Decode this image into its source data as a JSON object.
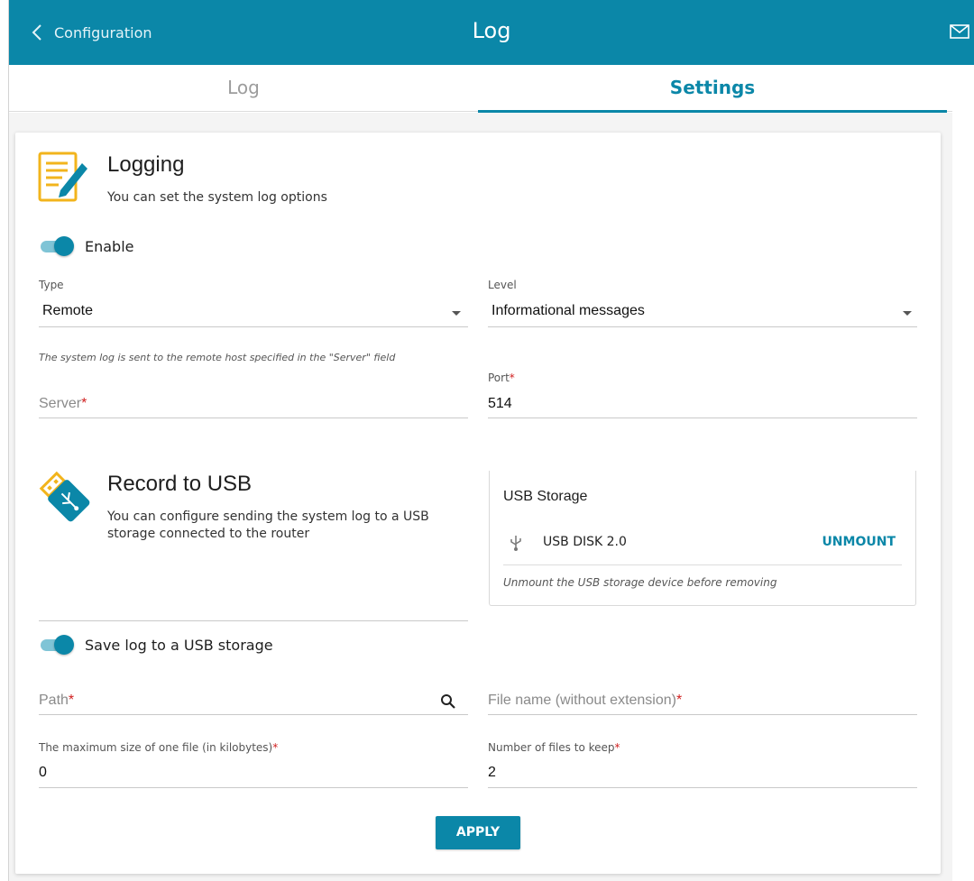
{
  "header": {
    "back_label": "Configuration",
    "title": "Log",
    "mail_icon": "mail-icon"
  },
  "tabs": [
    {
      "label": "Log",
      "active": false
    },
    {
      "label": "Settings",
      "active": true
    }
  ],
  "logging": {
    "title": "Logging",
    "description": "You can set the system log options",
    "icon": "notepad-pencil-icon",
    "enable_label": "Enable",
    "enable_on": true,
    "type_label": "Type",
    "type_value": "Remote",
    "level_label": "Level",
    "level_value": "Informational messages",
    "type_hint": "The system log is sent to the remote host specified in the \"Server\" field",
    "server_placeholder": "Server",
    "port_label": "Port",
    "port_value": "514",
    "required_mark": "*"
  },
  "usb": {
    "title": "Record to USB",
    "description": "You can configure sending the system log to a USB storage connected to the router",
    "icon": "usb-stick-icon",
    "storage_title": "USB Storage",
    "device_name": "USB DISK 2.0",
    "unmount_label": "UNMOUNT",
    "unmount_hint": "Unmount the USB storage device before removing",
    "save_label": "Save log to a USB storage",
    "save_on": true,
    "path_placeholder": "Path",
    "filename_placeholder": "File name (without extension)",
    "max_size_label": "The maximum size of one file (in kilobytes)",
    "max_size_value": "0",
    "files_keep_label": "Number of files to keep",
    "files_keep_value": "2"
  },
  "apply_label": "APPLY",
  "colors": {
    "accent": "#0b87a8",
    "required": "#d12020",
    "icon_yellow": "#f2b41c"
  }
}
